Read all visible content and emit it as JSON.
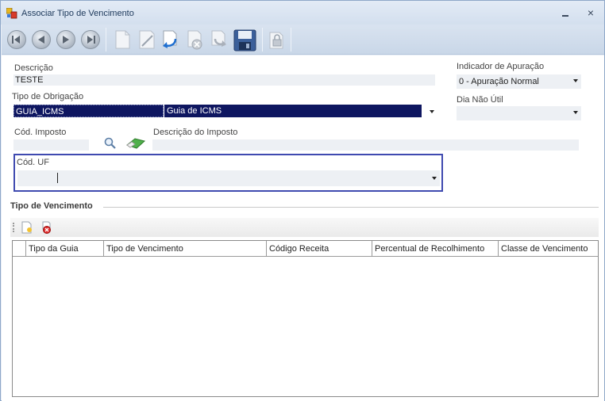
{
  "window": {
    "title": "Associar Tipo de Vencimento",
    "minimize_label": "_",
    "close_label": "×"
  },
  "toolbar": {
    "buttons": [
      "first-icon",
      "previous-icon",
      "next-icon",
      "last-icon",
      "new-icon",
      "edit-icon",
      "undo-icon",
      "delete-icon",
      "redo-icon",
      "save-icon",
      "lock-icon"
    ]
  },
  "form": {
    "descricao_label": "Descrição",
    "descricao_value": "TESTE",
    "tipo_obrigacao_label": "Tipo de Obrigação",
    "tipo_obrigacao_code": "GUIA_ICMS",
    "tipo_obrigacao_desc": "Guia de ICMS",
    "cod_imposto_label": "Cód. Imposto",
    "cod_imposto_value": "",
    "descricao_imposto_label": "Descrição do Imposto",
    "descricao_imposto_value": "",
    "indicador_apuracao_label": "Indicador de Apuração",
    "indicador_apuracao_value": "0 - Apuração Normal",
    "dia_nao_util_label": "Dia Não Útil",
    "dia_nao_util_value": "",
    "cod_uf_label": "Cód. UF",
    "cod_uf_value": ""
  },
  "section": {
    "title": "Tipo de Vencimento"
  },
  "grid": {
    "columns": [
      "Tipo da Guia",
      "Tipo de Vencimento",
      "Código Receita",
      "Percentual de Recolhimento",
      "Classe de Vencimento"
    ],
    "rows": []
  }
}
